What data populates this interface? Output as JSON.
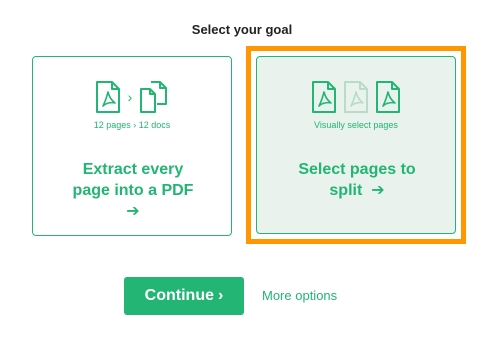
{
  "heading": "Select your goal",
  "options": [
    {
      "caption": "12 pages › 12 docs",
      "title_line1": "Extract every",
      "title_line2": "page into a PDF",
      "arrow": "➔",
      "separator": "›"
    },
    {
      "caption": "Visually select pages",
      "title_line1": "Select pages to",
      "title_line2": "split",
      "arrow": "➔",
      "selected": true
    }
  ],
  "continue_label": "Continue",
  "continue_chevron": "›",
  "more_options_label": "More options",
  "colors": {
    "accent": "#22b573",
    "highlight": "#ff9800",
    "selected_bg": "#e9f2ec"
  },
  "icons": [
    "pdf-file-icon",
    "multiple-documents-icon"
  ]
}
